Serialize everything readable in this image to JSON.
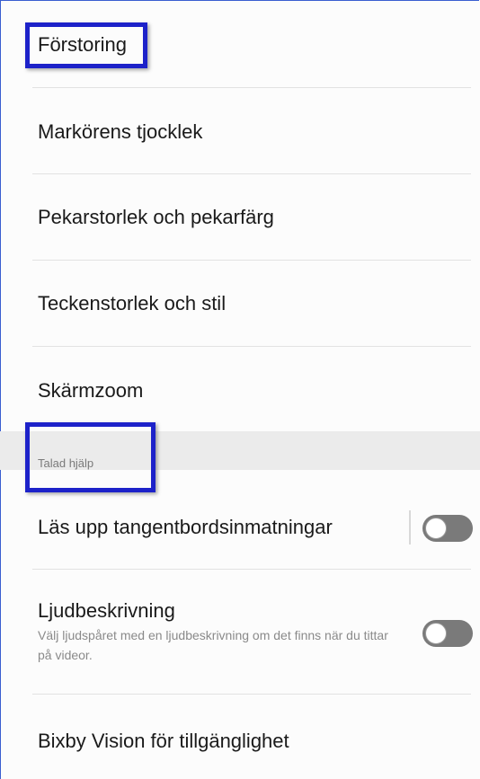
{
  "items": [
    {
      "label": "Förstoring"
    },
    {
      "label": "Markörens tjocklek"
    },
    {
      "label": "Pekarstorlek och pekarfärg"
    },
    {
      "label": "Teckenstorlek och stil"
    },
    {
      "label": "Skärmzoom"
    }
  ],
  "section": {
    "label": "Talad hjälp"
  },
  "spoken": [
    {
      "label": "Läs upp tangentbordsinmatningar",
      "toggle_on": false
    },
    {
      "label": "Ljudbeskrivning",
      "sublabel": "Välj ljudspåret med en ljudbeskrivning om det finns när du tittar på videor.",
      "toggle_on": false
    },
    {
      "label": "Bixby Vision för tillgänglighet"
    }
  ],
  "colors": {
    "highlight": "#1d22c9",
    "toggle_off": "#7a7a7a"
  }
}
